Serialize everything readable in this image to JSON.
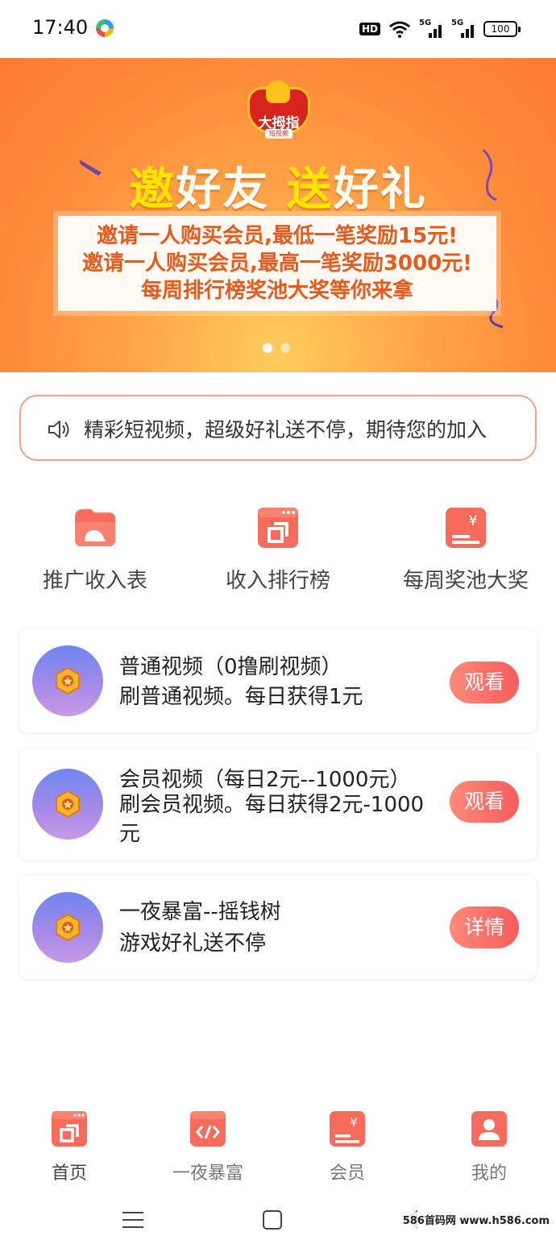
{
  "status_bar": {
    "time": "17:40",
    "network_badge": "HD",
    "signal1_label": "5G",
    "signal2_label": "5G",
    "battery": "100"
  },
  "banner": {
    "logo_text": "大拇指",
    "logo_sub": "短视频",
    "headline_part1_highlight": "邀",
    "headline_part1_rest": "好友",
    "headline_part2_highlight": "送",
    "headline_part2_rest": "好礼",
    "lines": [
      "邀请一人购买会员,最低一笔奖励15元!",
      "邀请一人购买会员,最高一笔奖励3000元!",
      "每周排行榜奖池大奖等你来拿"
    ],
    "active_slide": 1,
    "slide_count": 2
  },
  "notice": {
    "icon": "speaker-icon",
    "text": "精彩短视频，超级好礼送不停，期待您的加入"
  },
  "quick_actions": [
    {
      "label": "推广收入表",
      "icon": "folder-image-icon"
    },
    {
      "label": "收入排行榜",
      "icon": "window-copy-icon"
    },
    {
      "label": "每周奖池大奖",
      "icon": "yen-card-icon"
    }
  ],
  "tasks": [
    {
      "title": "普通视频（0撸刷视频）",
      "desc": "刷普通视频。每日获得1元",
      "button": "观看",
      "icon": "medal-icon"
    },
    {
      "title": "会员视频（每日2元--1000元）",
      "desc": "刷会员视频。每日获得2元-1000元",
      "button": "观看",
      "icon": "medal-icon"
    },
    {
      "title": "一夜暴富--摇钱树",
      "desc": "游戏好礼送不停",
      "button": "详情",
      "icon": "medal-icon"
    }
  ],
  "tabbar": [
    {
      "label": "首页",
      "icon": "home-window-icon",
      "active": true
    },
    {
      "label": "一夜暴富",
      "icon": "code-icon",
      "active": false
    },
    {
      "label": "会员",
      "icon": "yen-card-icon",
      "active": false
    },
    {
      "label": "我的",
      "icon": "user-icon",
      "active": false
    }
  ],
  "watermark": "586首码网 www.h586.com",
  "colors": {
    "accent": "#f76b5e",
    "banner_orange": "#ff8a3a",
    "banner_text": "#e85a1c",
    "headline_yellow": "#ffe500"
  }
}
